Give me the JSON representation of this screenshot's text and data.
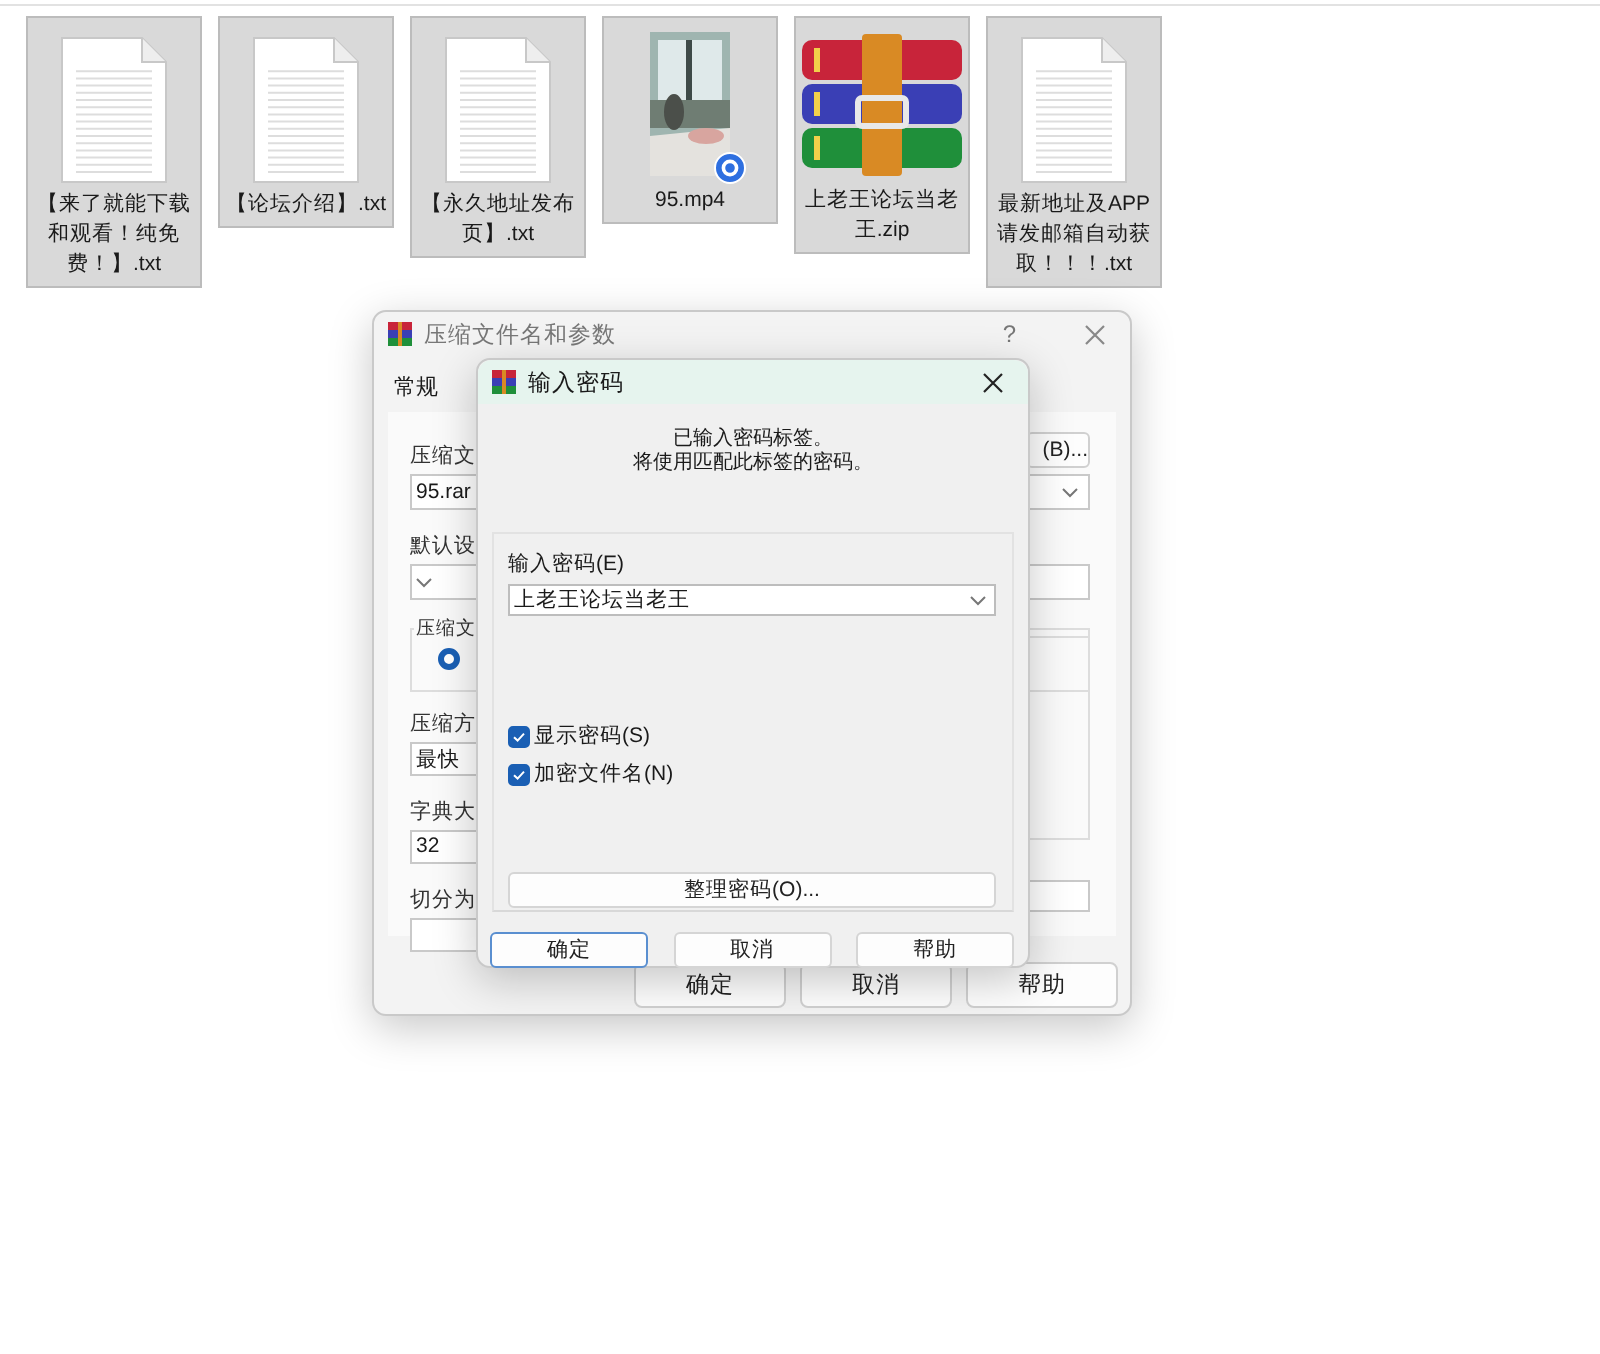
{
  "files": [
    {
      "name": "【来了就能下载和观看！纯免费！】.txt",
      "kind": "document",
      "selected": true
    },
    {
      "name": "【论坛介绍】.txt",
      "kind": "document",
      "selected": true
    },
    {
      "name": "【永久地址发布页】.txt",
      "kind": "document",
      "selected": true
    },
    {
      "name": "95.mp4",
      "kind": "video",
      "selected": true
    },
    {
      "name": "上老王论坛当老王.zip",
      "kind": "archive",
      "selected": true
    },
    {
      "name": "最新地址及APP请发邮箱自动获取！！！.txt",
      "kind": "document",
      "selected": true
    }
  ],
  "archive_dialog": {
    "title": "压缩文件名和参数",
    "help": "?",
    "tabs": [
      {
        "label": "常规",
        "selected": true
      }
    ],
    "archive_name_label": "压缩文",
    "archive_name": "95.rar",
    "browse_button": "(B)...",
    "profile_label": "默认设",
    "format_group_label": "压缩文",
    "format_radio_selected": true,
    "method_label": "压缩方",
    "method": "最快",
    "dictionary_label": "字典大",
    "dictionary": "32",
    "split_label": "切分为",
    "buttons": [
      {
        "label": "确定"
      },
      {
        "label": "取消"
      },
      {
        "label": "帮助"
      }
    ]
  },
  "password_dialog": {
    "title": "输入密码",
    "message_lines": [
      "已输入密码标签。",
      "将使用匹配此标签的密码。"
    ],
    "password_label": "输入密码(E)",
    "password": "上老王论坛当老王",
    "options": [
      {
        "label": "显示密码(S)",
        "checked": true
      },
      {
        "label": "加密文件名(N)",
        "checked": true
      }
    ],
    "organize_button": "整理密码(O)...",
    "buttons": [
      {
        "label": "确定",
        "default": true
      },
      {
        "label": "取消",
        "default": false
      },
      {
        "label": "帮助",
        "default": false
      }
    ]
  }
}
